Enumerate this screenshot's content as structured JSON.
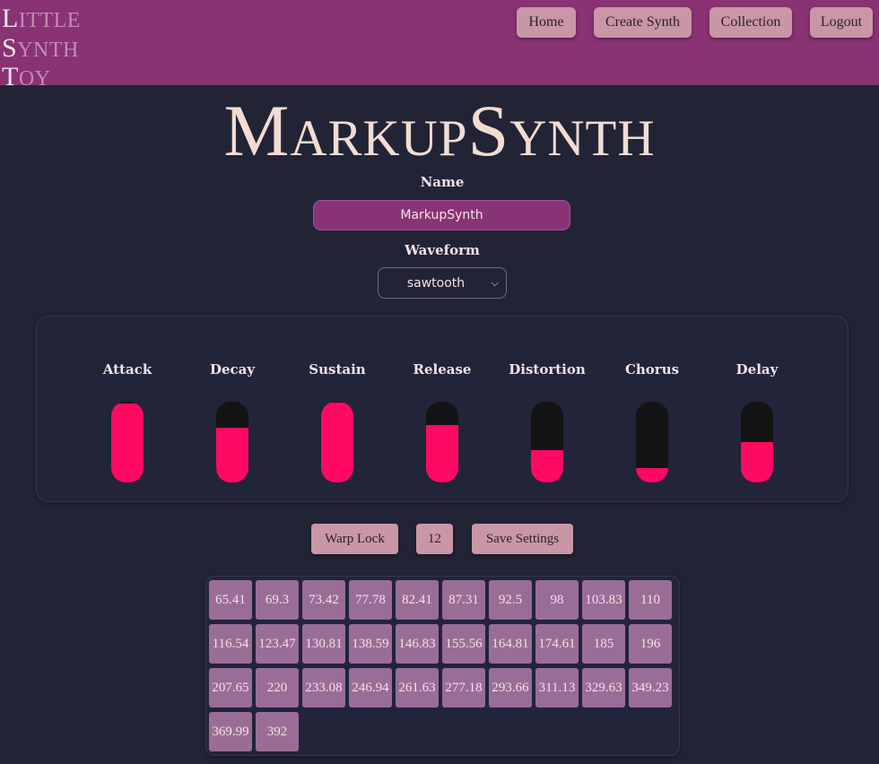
{
  "logo": {
    "lines": [
      {
        "cap": "L",
        "rest": "ITTLE"
      },
      {
        "cap": "S",
        "rest": "YNTH"
      },
      {
        "cap": "T",
        "rest": "OY"
      }
    ]
  },
  "nav": {
    "home": "Home",
    "create": "Create Synth",
    "collection": "Collection",
    "logout": "Logout"
  },
  "page": {
    "title": "MarkupSynth"
  },
  "form": {
    "name_label": "Name",
    "name_value": "MarkupSynth",
    "waveform_label": "Waveform",
    "waveform_value": "sawtooth"
  },
  "sliders": [
    {
      "label": "Attack",
      "level": 0.98
    },
    {
      "label": "Decay",
      "level": 0.68
    },
    {
      "label": "Sustain",
      "level": 0.99
    },
    {
      "label": "Release",
      "level": 0.71
    },
    {
      "label": "Distortion",
      "level": 0.4
    },
    {
      "label": "Chorus",
      "level": 0.18
    },
    {
      "label": "Delay",
      "level": 0.5
    }
  ],
  "controls": {
    "warp_lock": "Warp Lock",
    "count": "12",
    "save": "Save Settings"
  },
  "keys": [
    "65.41",
    "69.3",
    "73.42",
    "77.78",
    "82.41",
    "87.31",
    "92.5",
    "98",
    "103.83",
    "110",
    "116.54",
    "123.47",
    "130.81",
    "138.59",
    "146.83",
    "155.56",
    "164.81",
    "174.61",
    "185",
    "196",
    "207.65",
    "220",
    "233.08",
    "246.94",
    "261.63",
    "277.18",
    "293.66",
    "311.13",
    "329.63",
    "349.23",
    "369.99",
    "392"
  ],
  "colors": {
    "header": "#893274",
    "background": "#222436",
    "button": "#c996a6",
    "slider_fill": "#ff0a63",
    "slider_track": "#141414",
    "key": "#9a6d96"
  }
}
